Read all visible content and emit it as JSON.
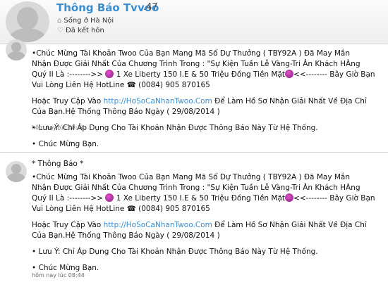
{
  "profile": {
    "name": "Thông Báo Tvvoo",
    "suffix": ".47",
    "location": "Sống ở Hà Nội",
    "status": "Đã kết hôn"
  },
  "posts": [
    {
      "title": "",
      "line1": "•Chúc Mừng Tài Khoản Twoo Của Bạn Mang Mã Số Dự Thưởng ( TBY92A ) Đã May Mắn",
      "line2": "Nhận Được Giải Nhất Của Chương Trình Trong : \"Sự Kiện Tuần Lễ Vàng-Tri Ân Khách HÀng",
      "line3a": "Quý II Là :-------->>",
      "line3b": "1 Xe Liberty 150 I.E & 50 Triệu Đồng Tiền Mặt",
      "line3c": "<<-------- Bây Giờ Bạn",
      "line4": "Vui Lòng Liên Hệ HotLine ☎ (0084) 905 870165",
      "visit_prefix": "Hoặc Truy Cập Vào",
      "link": "http://HoSoCaNhanTwoo.Com",
      "visit_suffix": "Để Làm Hồ Sơ Nhận Giải Nhất Về Địa Chỉ",
      "line6": "Của Bạn.Hệ Thống Thông Báo Ngày ( 29/08/2014 )",
      "note": "• Lưu Ý: Chỉ Áp Dụng Cho Tài Khoản Nhận Được Thông Báo Này Từ Hệ Thống.",
      "congrats": "• Chúc Mừng Bạn.",
      "timestamp": "hôm nay lúc 08:44"
    },
    {
      "title": "* Thông Báo *",
      "line1": "•Chúc Mừng Tài Khoản Twoo Của Bạn Mang Mã Số Dự Thưởng ( TBY92A ) Đã May Mắn",
      "line2": "Nhận Được Giải Nhất Của Chương Trình Trong : \"Sự Kiện Tuần Lễ Vàng-Tri Ân Khách HÀng",
      "line3a": "Quý II Là :-------->>",
      "line3b": "1 Xe Liberty 150 I.E & 50 Triệu Đồng Tiền Mặt",
      "line3c": "<<-------- Bây Giờ Bạn",
      "line4": "Vui Lòng Liên Hệ HotLine ☎ (0084) 905 870165",
      "visit_prefix": "Hoặc Truy Cập Vào",
      "link": "http://HoSoCaNhanTwoo.Com",
      "visit_suffix": "Để Làm Hồ Sơ Nhận Giải Nhất Về Địa Chỉ",
      "line6": "Của Bạn.Hệ Thống Thông Báo Ngày ( 29/08/2014 )",
      "note": "• Lưu Ý: Chỉ Áp Dụng Cho Tài Khoản Nhận Được Thông Báo Này Từ Hệ Thống.",
      "congrats": "• Chúc Mừng Bạn.",
      "timestamp": "hôm nay lúc 08:44"
    }
  ]
}
